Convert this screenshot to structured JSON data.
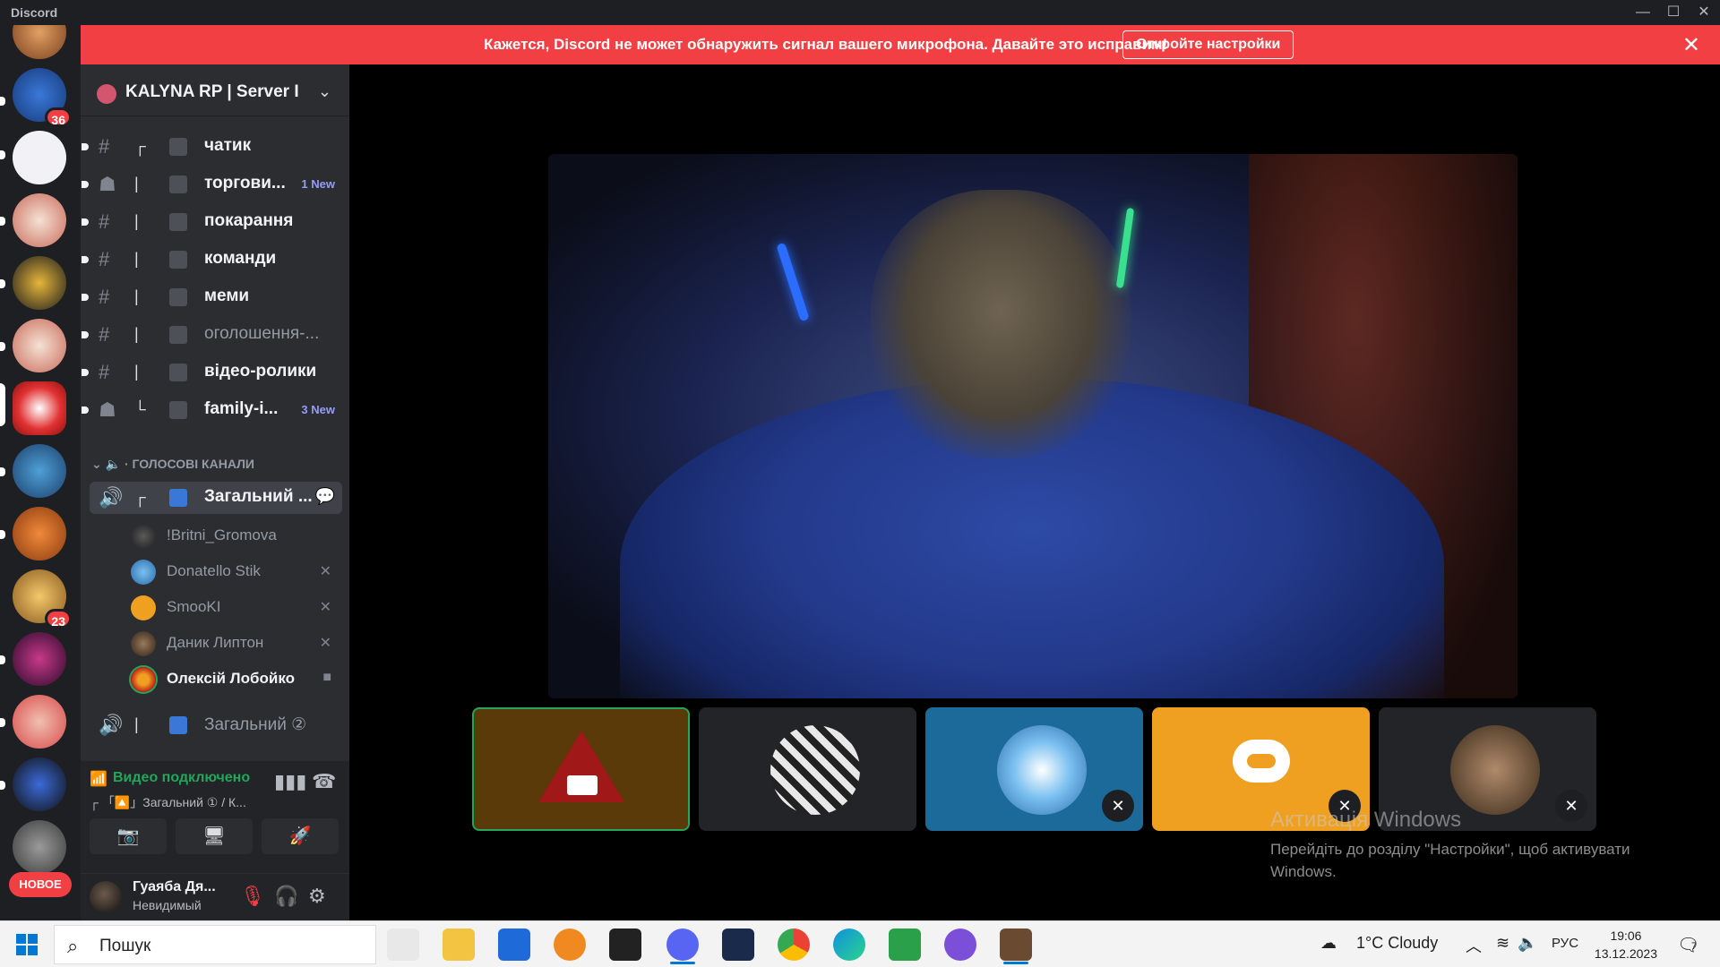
{
  "window": {
    "brand": "Discord",
    "minimize": "—",
    "maximize": "☐",
    "close": "✕"
  },
  "banner": {
    "message": "Кажется, Discord не может обнаружить сигнал вашего микрофона. Давайте это исправим!",
    "button": "Откройте настройки",
    "close": "✕"
  },
  "server_rail": {
    "badges": {
      "rpworld": "36",
      "avatar_user": "23"
    },
    "new_pill": "НОВОЕ"
  },
  "server": {
    "name": "KALYNA RP | Server I",
    "chevron": "⌄"
  },
  "channels": [
    {
      "tree": "┌",
      "emoji": "💬",
      "label": "чатик",
      "new": ""
    },
    {
      "tree": "|",
      "emoji": "💸",
      "label": "торгови...",
      "new": "1 New"
    },
    {
      "tree": "|",
      "emoji": "👮",
      "label": "покарання",
      "new": ""
    },
    {
      "tree": "|",
      "emoji": "🛡",
      "label": "команди",
      "new": ""
    },
    {
      "tree": "|",
      "emoji": "🃏",
      "label": "меми",
      "new": ""
    },
    {
      "tree": "|",
      "emoji": "👮",
      "label": "оголошення-...",
      "new": ""
    },
    {
      "tree": "|",
      "emoji": "🎬",
      "label": "відео-ролики",
      "new": ""
    },
    {
      "tree": "└",
      "emoji": "🏍",
      "label": "family-i...",
      "new": "3 New"
    }
  ],
  "voice_category": "ГОЛОСОВІ КАНАЛИ",
  "voice_channels": {
    "active": {
      "tree": "┌",
      "emoji": "🔼",
      "label": "Загальний ..."
    },
    "second": {
      "tree": "|",
      "emoji": "🔽",
      "label": "Загальний ②"
    }
  },
  "members": [
    {
      "name": "!Britni_Gromova",
      "status": ""
    },
    {
      "name": "Donatello Stik",
      "status": "🎤̸"
    },
    {
      "name": "SmooKI",
      "status": "🎤̸"
    },
    {
      "name": "Даник Липтон",
      "status": "🎤̸"
    },
    {
      "name": "Олексій Лобойко",
      "status": "📹"
    }
  ],
  "voice_panel": {
    "status": "Видео подключено",
    "channel": "┌ 「🔼」Загальний ① / К...",
    "buttons": [
      "📷",
      "🖥",
      "🚀"
    ]
  },
  "user": {
    "name": "Гуаяба Дя...",
    "status": "Невидимый"
  },
  "activate_windows": {
    "title": "Активація Windows",
    "text": "Перейдіть до розділу \"Настройки\", щоб активувати Windows."
  },
  "taskbar": {
    "search_placeholder": "Пошук",
    "weather": "1°C  Cloudy",
    "language": "РУС",
    "time": "19:06",
    "date": "13.12.2023",
    "notifications": "7"
  }
}
